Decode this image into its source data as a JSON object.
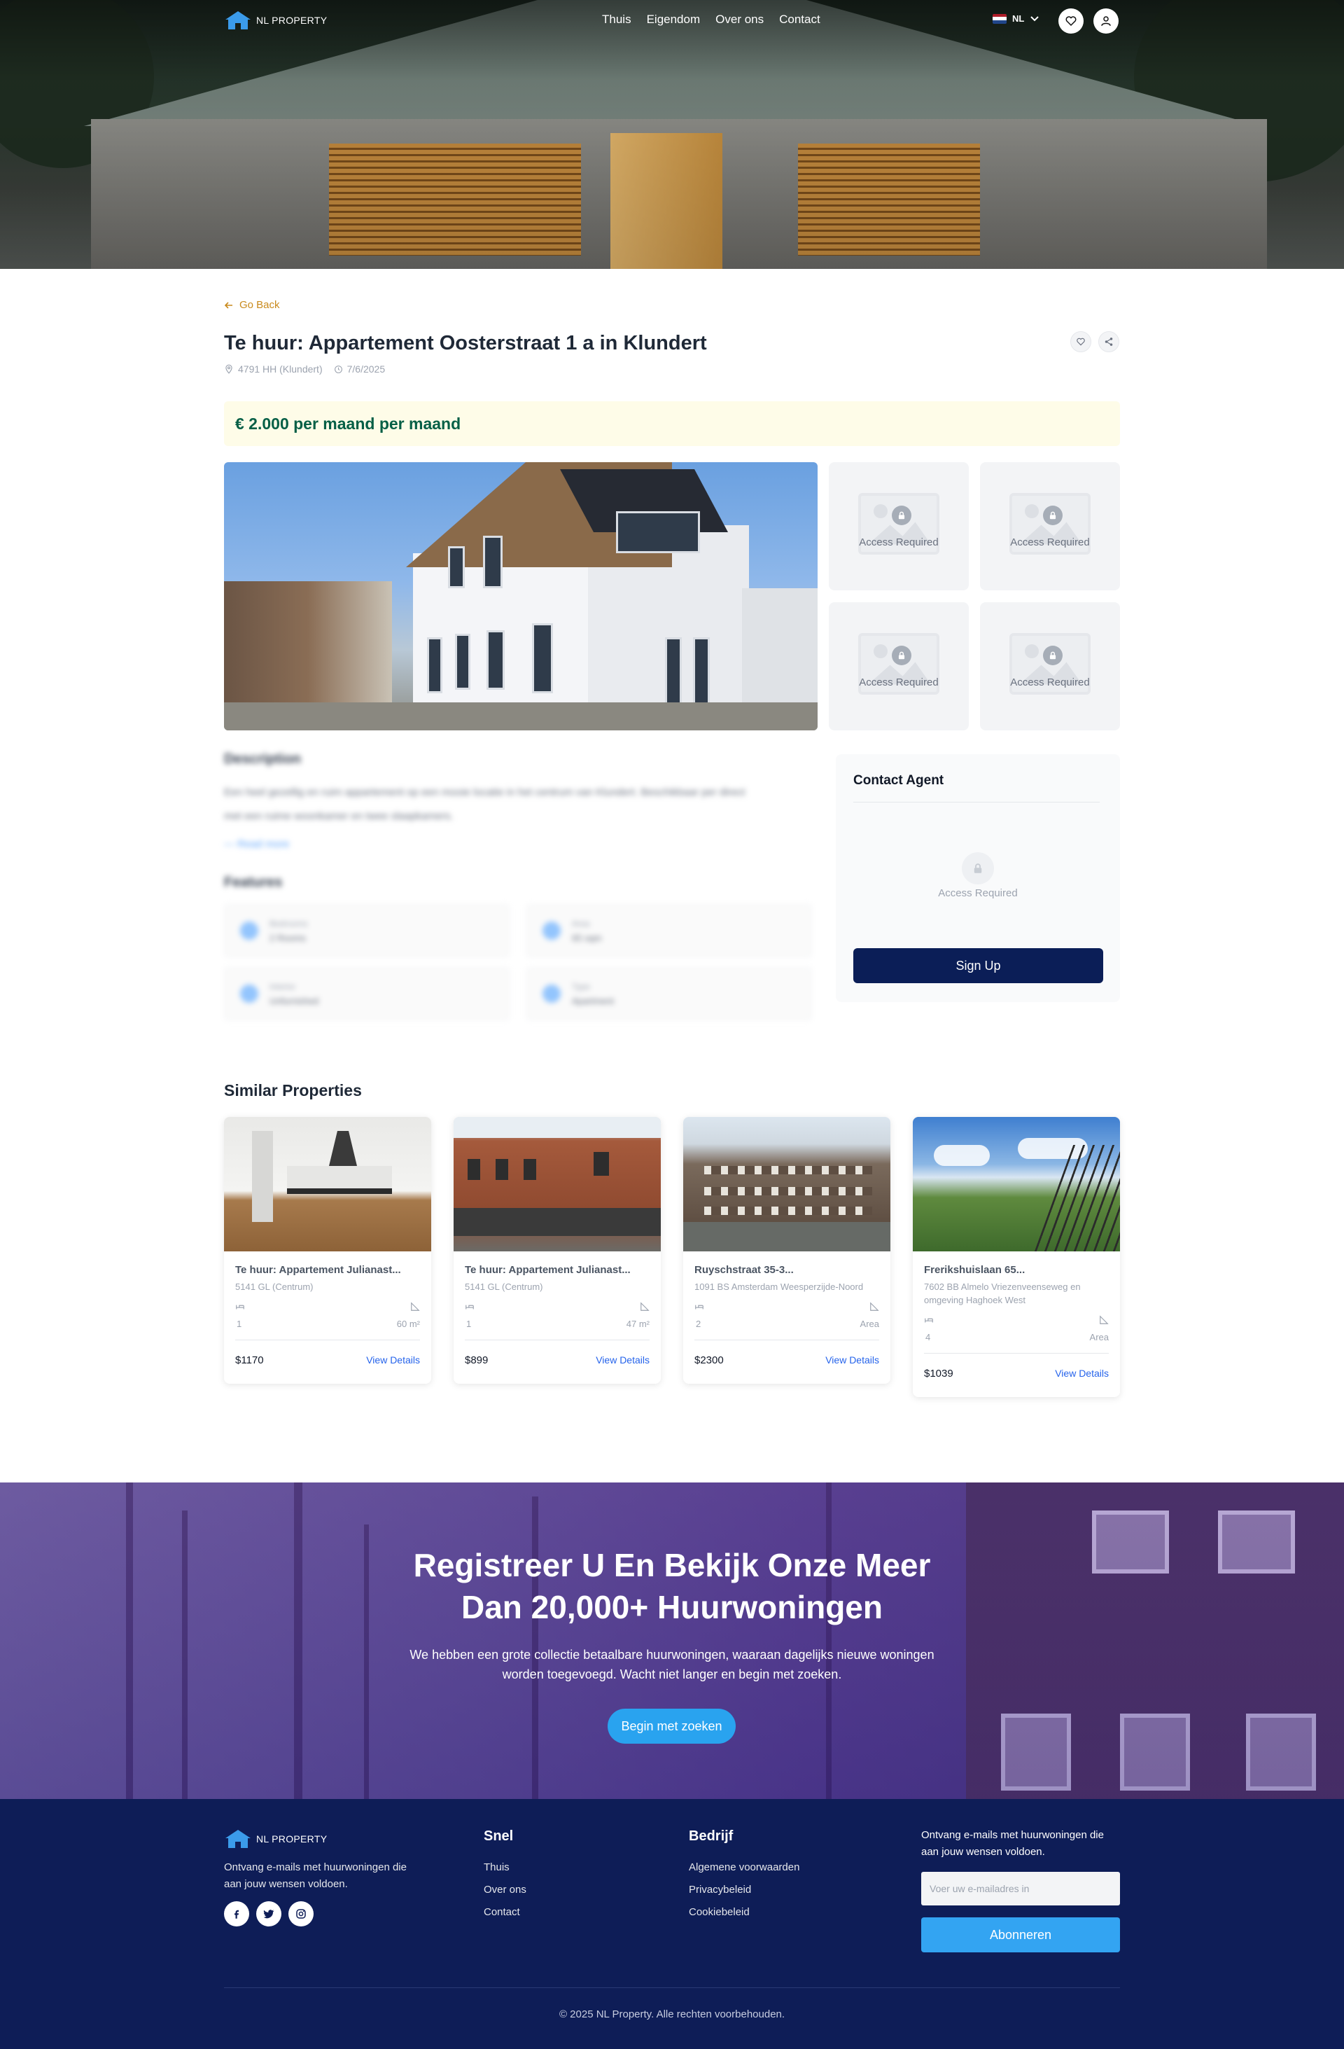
{
  "brand": {
    "name": "NL PROPERTY"
  },
  "nav": {
    "links": [
      "Thuis",
      "Eigendom",
      "Over ons",
      "Contact"
    ],
    "language": "NL",
    "icons": [
      "heart-icon",
      "user-icon"
    ]
  },
  "property": {
    "back_label": "Go Back",
    "title": "Te huur: Appartement Oosterstraat 1 a in Klundert",
    "postcode": "4791 HH (Klundert)",
    "date": "7/6/2025",
    "price": "€ 2.000 per maand per maand",
    "locked_label": "Access Required"
  },
  "details": {
    "description_heading": "Description",
    "description_text_1": "Een heel gezellig en ruim appartement op een mooie locatie in het centrum van Klundert. Beschikbaar per direct",
    "description_text_2": "met een ruime woonkamer en twee slaapkamers.",
    "read_more": "— Read more",
    "features_heading": "Features",
    "features": [
      {
        "label": "Bedrooms",
        "value": "2 Rooms"
      },
      {
        "label": "Area",
        "value": "65 sqm"
      },
      {
        "label": "Interior",
        "value": "Unfurnished"
      },
      {
        "label": "Type",
        "value": "Apartment"
      }
    ]
  },
  "agent": {
    "title": "Contact Agent",
    "locked_label": "Access Required",
    "signup_label": "Sign Up"
  },
  "similar": {
    "heading": "Similar Properties",
    "view_label": "View Details",
    "cards": [
      {
        "title": "Te huur: Appartement Julianast...",
        "address": "5141 GL (Centrum)",
        "beds": "1",
        "area": "60 m²",
        "price": "$1170"
      },
      {
        "title": "Te huur: Appartement Julianast...",
        "address": "5141 GL (Centrum)",
        "beds": "1",
        "area": "47 m²",
        "price": "$899"
      },
      {
        "title": "Ruyschstraat 35-3...",
        "address": "1091 BS Amsterdam Weesperzijde-Noord",
        "beds": "2",
        "area": "Area",
        "price": "$2300"
      },
      {
        "title": "Frerikshuislaan 65...",
        "address": "7602 BB Almelo Vriezenveenseweg en omgeving Haghoek West",
        "beds": "4",
        "area": "Area",
        "price": "$1039"
      }
    ]
  },
  "cta": {
    "heading_line1": "Registreer U En Bekijk Onze Meer",
    "heading_line2": "Dan 20,000+ Huurwoningen",
    "text_line1": "We hebben een grote collectie betaalbare huurwoningen, waaraan dagelijks nieuwe woningen",
    "text_line2": "worden toegevoegd. Wacht niet langer en begin met zoeken.",
    "button": "Begin met zoeken"
  },
  "footer": {
    "description": "Ontvang e-mails met huurwoningen die aan jouw wensen voldoen.",
    "col1_title": "Snel",
    "col1_links": [
      "Thuis",
      "Over ons",
      "Contact"
    ],
    "col2_title": "Bedrijf",
    "col2_links": [
      "Algemene voorwaarden",
      "Privacybeleid",
      "Cookiebeleid"
    ],
    "newsletter_text": "Ontvang e-mails met huurwoningen die aan jouw wensen voldoen.",
    "email_placeholder": "Voer uw e-mailadres in",
    "subscribe": "Abonneren",
    "copyright": "© 2025 NL Property. Alle rechten voorbehouden.",
    "social": [
      "facebook-icon",
      "twitter-icon",
      "instagram-icon"
    ]
  },
  "colors": {
    "accent_orange": "#c98a1c",
    "price_green": "#065f46",
    "navy": "#0e1d57",
    "button_blue": "#29a3ef",
    "link_blue": "#2563eb"
  }
}
